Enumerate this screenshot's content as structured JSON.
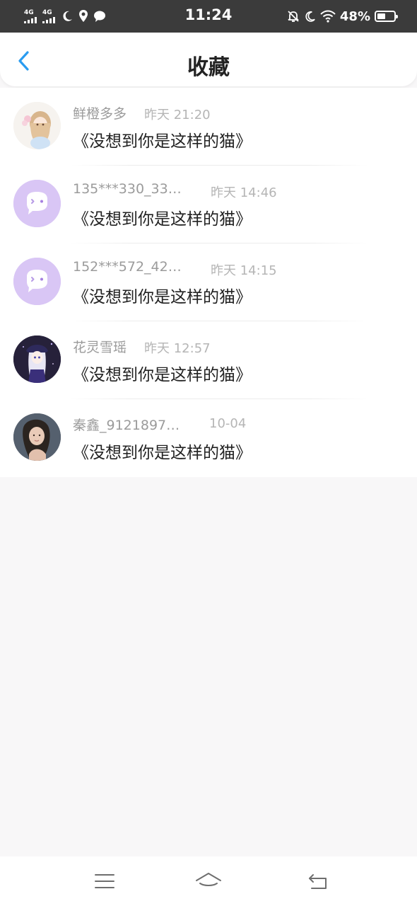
{
  "status_bar": {
    "time": "11:24",
    "battery": "48%",
    "signal_1": "4G",
    "signal_2": "4G",
    "battery_level": 0.48
  },
  "header": {
    "title": "收藏"
  },
  "favorites": [
    {
      "name": "鲜橙多多",
      "time": "昨天 21:20",
      "book": "《没想到你是这样的猫》",
      "avatar": "anime-girl-avatar"
    },
    {
      "name": "135***330_33…",
      "time": "昨天 14:46",
      "book": "《没想到你是这样的猫》",
      "avatar": "default-chat-avatar"
    },
    {
      "name": "152***572_42…",
      "time": "昨天 14:15",
      "book": "《没想到你是这样的猫》",
      "avatar": "default-chat-avatar"
    },
    {
      "name": "花灵雪瑶",
      "time": "昨天 12:57",
      "book": "《没想到你是这样的猫》",
      "avatar": "anime-dark-avatar"
    },
    {
      "name": "秦鑫_9121897…",
      "time": "10-04",
      "book": "《没想到你是这样的猫》",
      "avatar": "photo-avatar"
    }
  ],
  "colors": {
    "accent": "#2a9cf0",
    "default_avatar": "#d9c6f5"
  }
}
